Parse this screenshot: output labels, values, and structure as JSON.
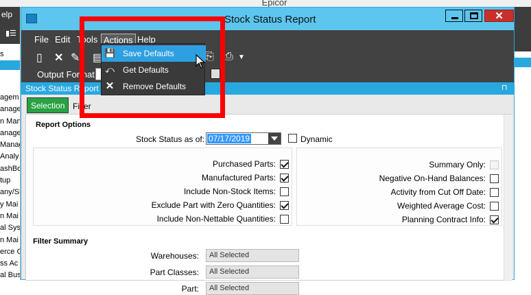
{
  "background_app": {
    "title": "Epicor",
    "menu_fragment": "elp",
    "tab_fragment": "s",
    "list_items": [
      "agem",
      "anage",
      "n Man",
      "anage",
      "Manag",
      "Analy",
      "ashBo",
      "tup",
      "any/Si",
      "y Mai",
      "n Mai",
      "al Sys",
      "n Mai",
      "erce C",
      "ss Ac",
      "al Bus",
      "ss Pro"
    ]
  },
  "window": {
    "title": "Stock Status Report",
    "minimize_label": "",
    "close_glyph": "✕"
  },
  "menubar": {
    "file": "File",
    "edit": "Edit",
    "tools": "Tools",
    "actions": "Actions",
    "help": "Help"
  },
  "toolbar": {
    "output_format_label": "Output Format:"
  },
  "actions_menu": {
    "items": [
      {
        "label": "Save Defaults",
        "icon": "save-icon",
        "highlighted": true
      },
      {
        "label": "Get Defaults",
        "icon": "get-defaults-icon",
        "highlighted": false
      },
      {
        "label": "Remove Defaults",
        "icon": "remove-icon",
        "highlighted": false
      }
    ]
  },
  "panel": {
    "title": "Stock Status Report",
    "pin_glyph": "⊓"
  },
  "tabs": {
    "selection": "Selection",
    "filter": "Filter"
  },
  "report_options": {
    "title": "Report Options",
    "stock_status_label": "Stock Status as of:",
    "stock_status_value": "07/17/2019",
    "dynamic_label": "Dynamic",
    "dynamic_checked": false,
    "left_options": [
      {
        "label": "Purchased Parts:",
        "checked": true
      },
      {
        "label": "Manufactured Parts:",
        "checked": true
      },
      {
        "label": "Include Non-Stock Items:",
        "checked": false
      },
      {
        "label": "Exclude Part with Zero Quantities:",
        "checked": true
      },
      {
        "label": "Include Non-Nettable Quantities:",
        "checked": false
      }
    ],
    "right_options": [
      {
        "label": "Summary Only:",
        "checked": false,
        "disabled": true
      },
      {
        "label": "Negative On-Hand Balances:",
        "checked": false,
        "disabled": false
      },
      {
        "label": "Activity from Cut Off Date:",
        "checked": false,
        "disabled": false
      },
      {
        "label": "Weighted Average Cost:",
        "checked": false,
        "disabled": false
      },
      {
        "label": "Planning Contract Info:",
        "checked": true,
        "disabled": false
      }
    ]
  },
  "filter_summary": {
    "title": "Filter Summary",
    "rows": [
      {
        "label": "Warehouses:",
        "value": "All Selected"
      },
      {
        "label": "Part Classes:",
        "value": "All Selected"
      },
      {
        "label": "Part:",
        "value": "All Selected"
      }
    ]
  },
  "colors": {
    "title_bar": "#5cc6ee",
    "menu_bar": "#424242",
    "panel_bar": "#29a8e0",
    "tab_active": "#27a342",
    "menu_highlight": "#2e9fe0",
    "annotation": "#ff0000"
  }
}
